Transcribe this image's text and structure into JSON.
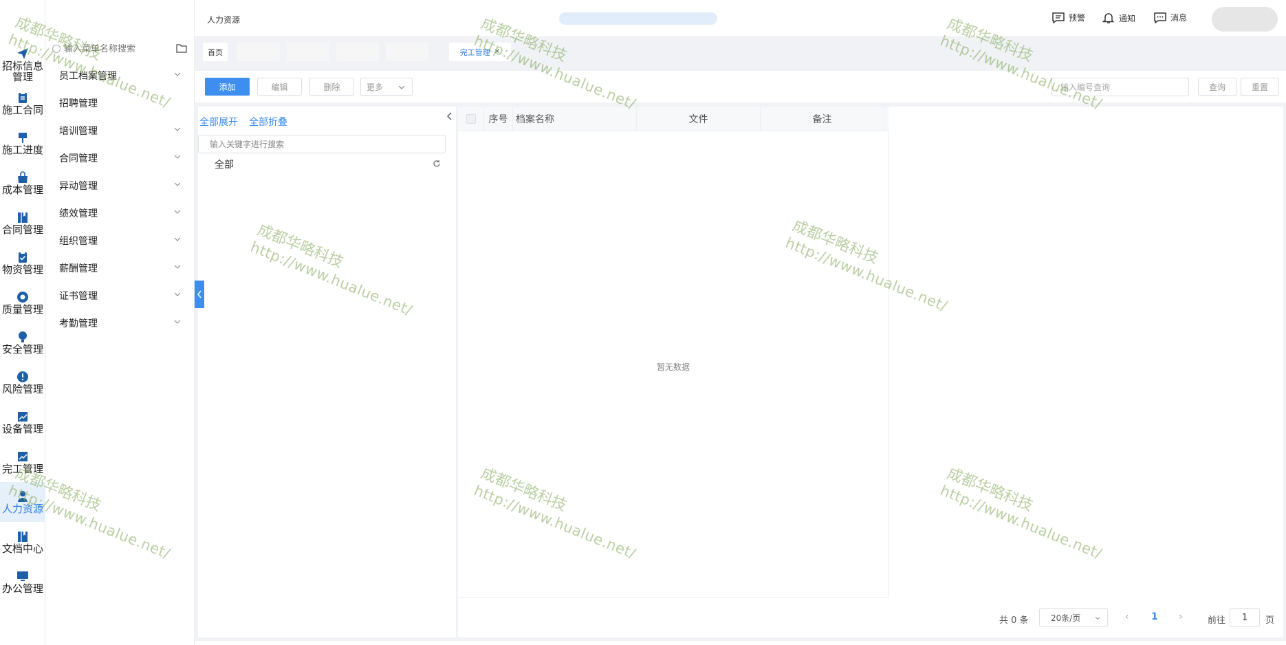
{
  "rail": {
    "items": [
      {
        "label": "招标信息\n管理",
        "icon": "paper-plane-icon"
      },
      {
        "label": "施工合同",
        "icon": "clipboard-icon"
      },
      {
        "label": "施工进度",
        "icon": "flag-icon"
      },
      {
        "label": "成本管理",
        "icon": "bag-icon"
      },
      {
        "label": "合同管理",
        "icon": "book-icon"
      },
      {
        "label": "物资管理",
        "icon": "clipboard-check-icon"
      },
      {
        "label": "质量管理",
        "icon": "shield-icon"
      },
      {
        "label": "安全管理",
        "icon": "bulb-icon"
      },
      {
        "label": "风险管理",
        "icon": "alert-icon"
      },
      {
        "label": "设备管理",
        "icon": "chart-icon"
      },
      {
        "label": "完工管理",
        "icon": "chart-icon"
      },
      {
        "label": "人力资源",
        "icon": "user-icon"
      },
      {
        "label": "文档中心",
        "icon": "book-icon"
      },
      {
        "label": "办公管理",
        "icon": "monitor-icon"
      }
    ],
    "active_index": 11,
    "accent": "#1f5fa8"
  },
  "submenu": {
    "search_placeholder": "输入菜单名称搜索",
    "items": [
      {
        "label": "员工档案管理",
        "has_children": true
      },
      {
        "label": "招聘管理",
        "has_children": false
      },
      {
        "label": "培训管理",
        "has_children": true
      },
      {
        "label": "合同管理",
        "has_children": true
      },
      {
        "label": "异动管理",
        "has_children": true
      },
      {
        "label": "绩效管理",
        "has_children": true
      },
      {
        "label": "组织管理",
        "has_children": true
      },
      {
        "label": "薪酬管理",
        "has_children": true
      },
      {
        "label": "证书管理",
        "has_children": true
      },
      {
        "label": "考勤管理",
        "has_children": true
      }
    ]
  },
  "header": {
    "title": "人力资源",
    "alert_label": "预警",
    "notify_label": "通知",
    "message_label": "消息"
  },
  "tabs": {
    "home": "首页",
    "active": "完工管理"
  },
  "toolbar": {
    "add": "添加",
    "edit": "编辑",
    "delete": "删除",
    "more": "更多",
    "search_placeholder": "输入编号查询",
    "query": "查询",
    "reset": "重置"
  },
  "tree": {
    "expand_all": "全部展开",
    "collapse_all": "全部折叠",
    "search_placeholder": "输入关键字进行搜索",
    "root": "全部"
  },
  "table": {
    "columns": [
      "序号",
      "档案名称",
      "文件",
      "备注"
    ],
    "empty_text": "暂无数据"
  },
  "pager": {
    "total": "共 0 条",
    "page_size": "20条/页",
    "current": "1",
    "goto_label": "前往",
    "goto_value": "1",
    "goto_unit": "页"
  },
  "watermark": {
    "line1": "成都华略科技",
    "line2": "http://www.hualue.net/"
  }
}
